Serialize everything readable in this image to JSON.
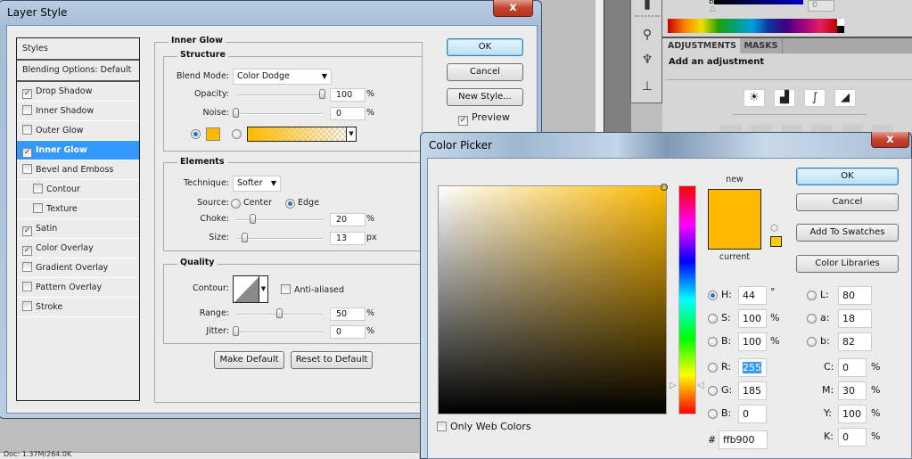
{
  "background": {
    "panel_tabs": [
      "ADJUSTMENTS",
      "MASKS"
    ],
    "add_adjustment_text": "Add an adjustment",
    "channel_label": "B",
    "channel_value": "0",
    "adjustment_icons": [
      "brightness-contrast",
      "levels",
      "curves",
      "exposure"
    ],
    "status_text": "Doc: 1.37M/264.0K"
  },
  "layer_style": {
    "title": "Layer Style",
    "close_label": "x",
    "styles_header": "Styles",
    "blending_options": "Blending Options: Default",
    "styles": [
      {
        "label": "Drop Shadow",
        "checked": true,
        "indent": false,
        "selected": false
      },
      {
        "label": "Inner Shadow",
        "checked": false,
        "indent": false,
        "selected": false
      },
      {
        "label": "Outer Glow",
        "checked": false,
        "indent": false,
        "selected": false
      },
      {
        "label": "Inner Glow",
        "checked": true,
        "indent": false,
        "selected": true
      },
      {
        "label": "Bevel and Emboss",
        "checked": false,
        "indent": false,
        "selected": false
      },
      {
        "label": "Contour",
        "checked": false,
        "indent": true,
        "selected": false
      },
      {
        "label": "Texture",
        "checked": false,
        "indent": true,
        "selected": false
      },
      {
        "label": "Satin",
        "checked": true,
        "indent": false,
        "selected": false
      },
      {
        "label": "Color Overlay",
        "checked": true,
        "indent": false,
        "selected": false
      },
      {
        "label": "Gradient Overlay",
        "checked": false,
        "indent": false,
        "selected": false
      },
      {
        "label": "Pattern Overlay",
        "checked": false,
        "indent": false,
        "selected": false
      },
      {
        "label": "Stroke",
        "checked": false,
        "indent": false,
        "selected": false
      }
    ],
    "section_title": "Inner Glow",
    "structure": {
      "legend": "Structure",
      "blend_mode_label": "Blend Mode:",
      "blend_mode_value": "Color Dodge",
      "opacity_label": "Opacity:",
      "opacity_value": "100",
      "opacity_unit": "%",
      "opacity_fraction": 1.0,
      "noise_label": "Noise:",
      "noise_value": "0",
      "noise_unit": "%",
      "noise_fraction": 0.0,
      "glow_color": "#ffb900",
      "color_mode": "solid"
    },
    "elements": {
      "legend": "Elements",
      "technique_label": "Technique:",
      "technique_value": "Softer",
      "source_label": "Source:",
      "source_center": "Center",
      "source_edge": "Edge",
      "source_selected": "Edge",
      "choke_label": "Choke:",
      "choke_value": "20",
      "choke_unit": "%",
      "choke_fraction": 0.2,
      "size_label": "Size:",
      "size_value": "13",
      "size_unit": "px",
      "size_fraction": 0.05
    },
    "quality": {
      "legend": "Quality",
      "contour_label": "Contour:",
      "anti_aliased_label": "Anti-aliased",
      "anti_aliased": false,
      "range_label": "Range:",
      "range_value": "50",
      "range_unit": "%",
      "range_fraction": 0.5,
      "jitter_label": "Jitter:",
      "jitter_value": "0",
      "jitter_unit": "%",
      "jitter_fraction": 0.0
    },
    "make_default": "Make Default",
    "reset_default": "Reset to Default",
    "ok": "OK",
    "cancel": "Cancel",
    "new_style": "New Style...",
    "preview_label": "Preview",
    "preview_checked": true
  },
  "color_picker": {
    "title": "Color Picker",
    "close_label": "x",
    "new_label": "new",
    "current_label": "current",
    "ok": "OK",
    "cancel": "Cancel",
    "add_to_swatches": "Add To Swatches",
    "color_libraries": "Color Libraries",
    "selected_color": "#ffb900",
    "hsb": {
      "H": "44",
      "S": "100",
      "B": "100",
      "H_unit": "°",
      "S_unit": "%",
      "B_unit": "%"
    },
    "rgb": {
      "R": "255",
      "G": "185",
      "B": "0"
    },
    "lab": {
      "L": "80",
      "a": "18",
      "b": "82"
    },
    "cmyk": {
      "C": "0",
      "M": "30",
      "Y": "100",
      "K": "0",
      "unit": "%"
    },
    "hex_label": "#",
    "hex": "ffb900",
    "selected_mode": "H",
    "only_web_colors_label": "Only Web Colors",
    "only_web_colors": false
  }
}
